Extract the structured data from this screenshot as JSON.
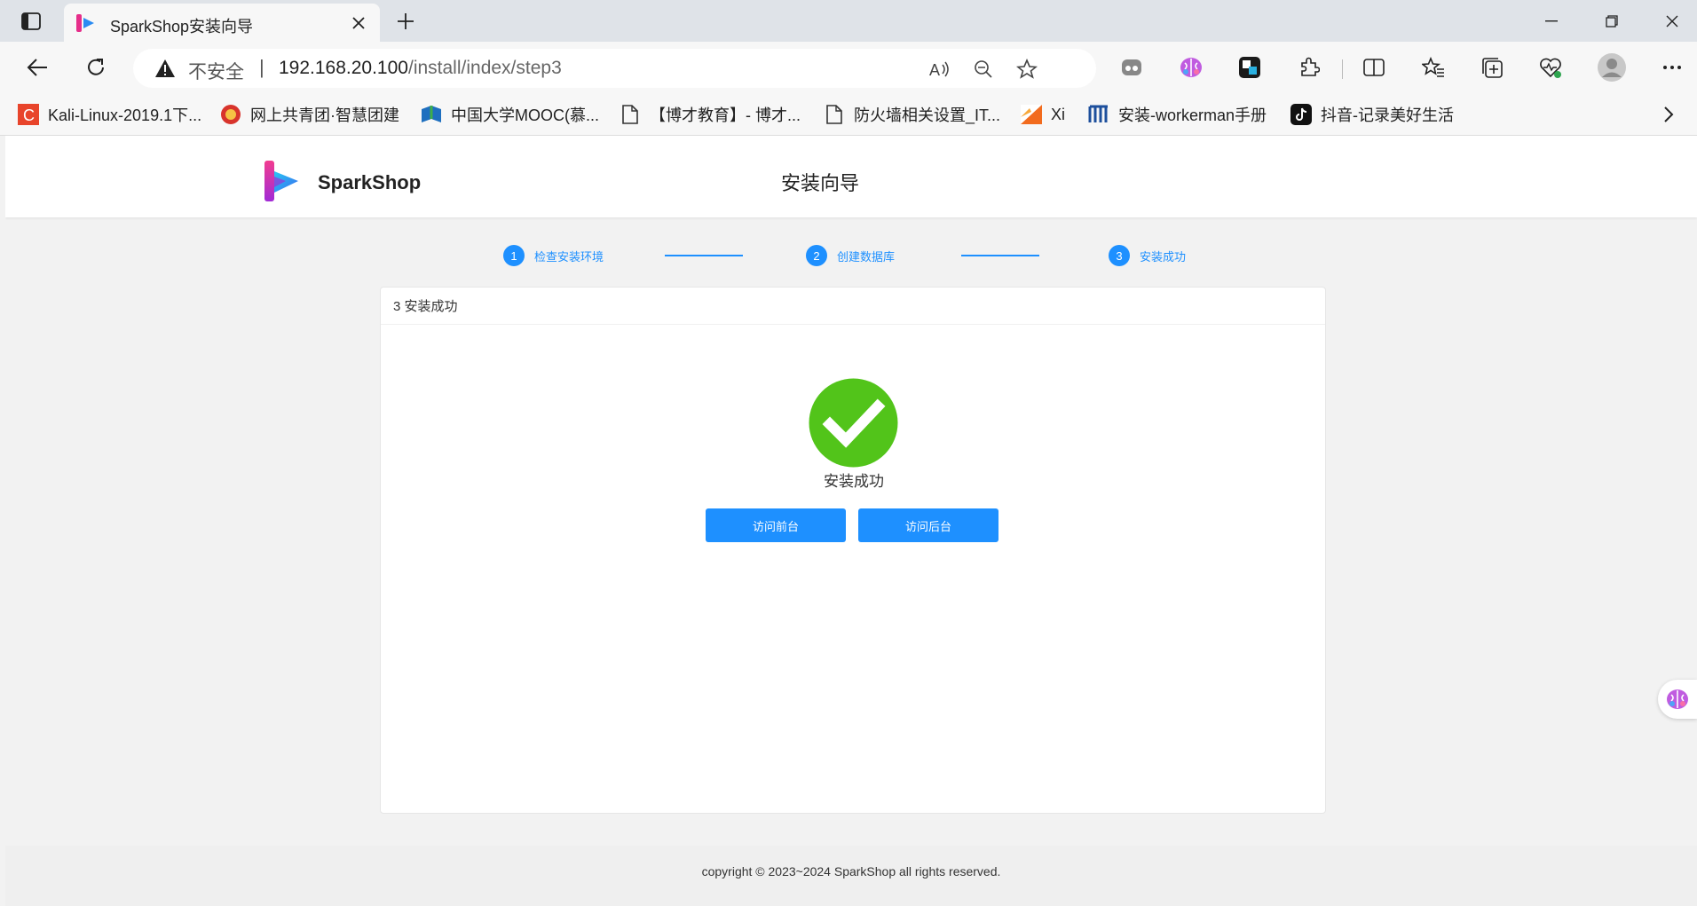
{
  "browser": {
    "tab": {
      "title": "SparkShop安装向导"
    },
    "address": {
      "security_label": "不安全",
      "url_host": "192.168.20.100",
      "url_path": "/install/index/step3"
    },
    "bookmarks": [
      {
        "label": "Kali-Linux-2019.1下...",
        "icon": "c-red-icon"
      },
      {
        "label": "网上共青团·智慧团建",
        "icon": "league-badge-icon"
      },
      {
        "label": "中国大学MOOC(慕...",
        "icon": "mooc-icon"
      },
      {
        "label": "【博才教育】- 博才...",
        "icon": "page-icon"
      },
      {
        "label": "防火墙相关设置_IT...",
        "icon": "page-icon"
      },
      {
        "label": "Xi",
        "icon": "xi-icon"
      },
      {
        "label": "安装-workerman手册",
        "icon": "workerman-icon"
      },
      {
        "label": "抖音-记录美好生活",
        "icon": "douyin-icon"
      }
    ]
  },
  "site": {
    "brand": "SparkShop",
    "header_title": "安装向导",
    "steps": [
      {
        "num": "1",
        "label": "检查安装环境"
      },
      {
        "num": "2",
        "label": "创建数据库"
      },
      {
        "num": "3",
        "label": "安装成功"
      }
    ],
    "card_title": "3 安装成功",
    "success_text": "安装成功",
    "buttons": {
      "frontend": "访问前台",
      "backend": "访问后台"
    },
    "footer": "copyright © 2023~2024 SparkShop all rights reserved."
  },
  "colors": {
    "accent": "#1e90ff",
    "success": "#52c41a"
  }
}
